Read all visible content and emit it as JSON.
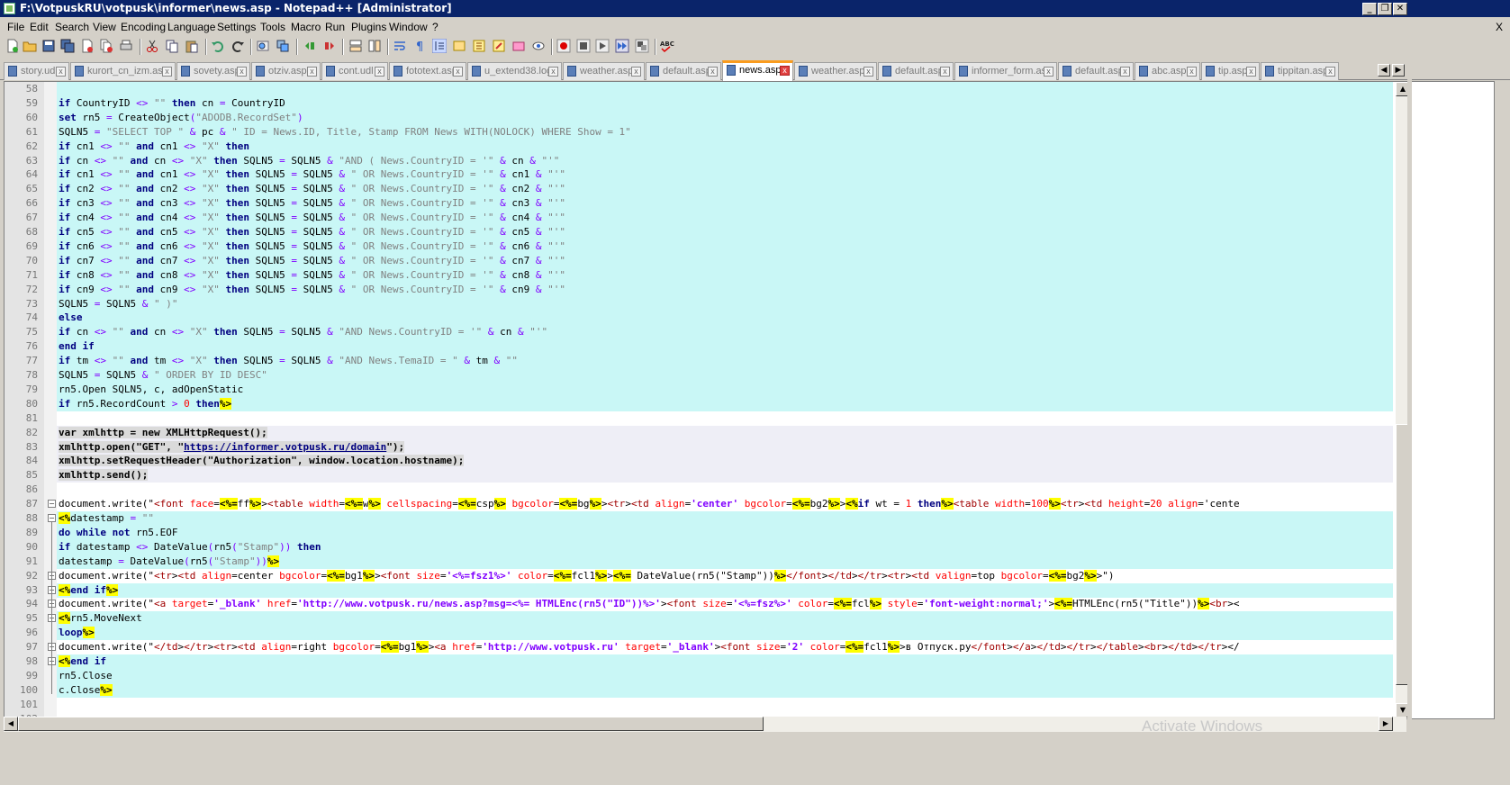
{
  "window": {
    "title": "F:\\VotpuskRU\\votpusk\\informer\\news.asp - Notepad++ [Administrator]",
    "controls": [
      "minimize",
      "restore",
      "close"
    ]
  },
  "menu": {
    "items": [
      "File",
      "Edit",
      "Search",
      "View",
      "Encoding",
      "Language",
      "Settings",
      "Tools",
      "Macro",
      "Run",
      "Plugins",
      "Window",
      "?"
    ],
    "close_label": "X"
  },
  "toolbar": {
    "icons": [
      "new-file-icon",
      "open-file-icon",
      "save-icon",
      "save-all-icon",
      "close-icon",
      "close-all-icon",
      "print-icon",
      "cut-icon",
      "copy-icon",
      "paste-icon",
      "undo-icon",
      "redo-icon",
      "find-icon",
      "replace-icon",
      "zoom-in-icon",
      "zoom-out-icon",
      "sync-v-icon",
      "sync-h-icon",
      "wrap-icon",
      "show-all-icon",
      "indent-guide-icon",
      "doc-map-icon",
      "function-list-icon",
      "folder-icon",
      "monitor-icon",
      "record-macro-icon",
      "stop-macro-icon",
      "play-macro-icon",
      "play-multiple-icon",
      "save-macro-icon",
      "spellcheck-icon"
    ],
    "spellcheck_label": "ABC"
  },
  "tabs": [
    {
      "label": "story.udl",
      "active": false
    },
    {
      "label": "kurort_cn_izm.asp",
      "active": false
    },
    {
      "label": "sovety.asp",
      "active": false
    },
    {
      "label": "otziv.asp",
      "active": false
    },
    {
      "label": "cont.udl",
      "active": false
    },
    {
      "label": "fototext.asp",
      "active": false
    },
    {
      "label": "u_extend38.log",
      "active": false
    },
    {
      "label": "weather.asp",
      "active": false
    },
    {
      "label": "default.asp",
      "active": false
    },
    {
      "label": "news.asp",
      "active": true
    },
    {
      "label": "weather.asp",
      "active": false
    },
    {
      "label": "default.asp",
      "active": false
    },
    {
      "label": "informer_form.asp",
      "active": false
    },
    {
      "label": "default.asp",
      "active": false
    },
    {
      "label": "abc.asp",
      "active": false
    },
    {
      "label": "tip.asp",
      "active": false
    },
    {
      "label": "tippitan.asp",
      "active": false
    }
  ],
  "editor": {
    "line_numbers": [
      "58",
      "59",
      "60",
      "61",
      "62",
      "63",
      "64",
      "65",
      "66",
      "67",
      "68",
      "69",
      "70",
      "71",
      "72",
      "73",
      "74",
      "75",
      "76",
      "77",
      "78",
      "79",
      "80",
      "81",
      "82",
      "83",
      "84",
      "85",
      "86",
      "87",
      "88",
      "89",
      "90",
      "91",
      "92",
      "93",
      "94",
      "95",
      "96",
      "97",
      "98",
      "99",
      "100",
      "101",
      "102"
    ],
    "lines": [
      "",
      "if CountryID <> \"\" then cn = CountryID",
      "set rn5 = CreateObject(\"ADODB.RecordSet\")",
      "SQLN5 = \"SELECT TOP \" & pc & \" ID = News.ID, Title, Stamp FROM News WITH(NOLOCK) WHERE Show = 1\"",
      "if cn1 <> \"\" and cn1 <> \"X\" then",
      "if cn <> \"\" and cn <> \"X\" then SQLN5 = SQLN5 & \"AND ( News.CountryID = '\" & cn & \"'\"",
      "if cn1 <> \"\" and cn1 <> \"X\" then SQLN5 = SQLN5 & \" OR News.CountryID = '\" & cn1 & \"'\"",
      "if cn2 <> \"\" and cn2 <> \"X\" then SQLN5 = SQLN5 & \" OR News.CountryID = '\" & cn2 & \"'\"",
      "if cn3 <> \"\" and cn3 <> \"X\" then SQLN5 = SQLN5 & \" OR News.CountryID = '\" & cn3 & \"'\"",
      "if cn4 <> \"\" and cn4 <> \"X\" then SQLN5 = SQLN5 & \" OR News.CountryID = '\" & cn4 & \"'\"",
      "if cn5 <> \"\" and cn5 <> \"X\" then SQLN5 = SQLN5 & \" OR News.CountryID = '\" & cn5 & \"'\"",
      "if cn6 <> \"\" and cn6 <> \"X\" then SQLN5 = SQLN5 & \" OR News.CountryID = '\" & cn6 & \"'\"",
      "if cn7 <> \"\" and cn7 <> \"X\" then SQLN5 = SQLN5 & \" OR News.CountryID = '\" & cn7 & \"'\"",
      "if cn8 <> \"\" and cn8 <> \"X\" then SQLN5 = SQLN5 & \" OR News.CountryID = '\" & cn8 & \"'\"",
      "if cn9 <> \"\" and cn9 <> \"X\" then SQLN5 = SQLN5 & \" OR News.CountryID = '\" & cn9 & \"'\"",
      "SQLN5 = SQLN5 & \" )\"",
      "else",
      "if cn <> \"\" and cn <> \"X\" then SQLN5 = SQLN5 & \"AND News.CountryID = '\" & cn & \"'\"",
      "end if",
      "if tm <> \"\" and tm <> \"X\" then SQLN5 = SQLN5 & \"AND News.TemaID = \" & tm & \"\"",
      "SQLN5 = SQLN5 & \" ORDER BY ID DESC\"",
      "rn5.Open SQLN5, c, adOpenStatic",
      "if rn5.RecordCount > 0 then%>",
      "",
      "var xmlhttp = new XMLHttpRequest();",
      "xmlhttp.open(\"GET\", \"https://informer.votpusk.ru/domain\");",
      "xmlhttp.setRequestHeader(\"Authorization\", window.location.hostname);",
      "xmlhttp.send();",
      "",
      "document.write(\"<font face=<%=ff%>><table width=<%=w%> cellspacing=<%=csp%> bgcolor=<%=bg%>><tr><td align='center' bgcolor=<%=bg2%>><%if wt = 1 then%><table width=100%><tr><td height=20 align='cente",
      "<%datestamp = \"\"",
      "do while not rn5.EOF",
      "if datestamp <> DateValue(rn5(\"Stamp\")) then",
      "datestamp = DateValue(rn5(\"Stamp\"))%>",
      "document.write(\"<tr><td align=center bgcolor=<%=bg1%>><font size='<%=fsz1%>' color=<%=fcl1%>><%= DateValue(rn5(\"Stamp\"))%></font></td></tr><tr><td valign=top bgcolor=<%=bg2%>>\")",
      "<%end if%>",
      "document.write(\"<a target='_blank' href='http://www.votpusk.ru/news.asp?msg=<%= HTMLEnc(rn5(\"ID\"))%>'><font size='<%=fsz%>' color=<%=fcl%> style='font-weight:normal;'><%=HTMLEnc(rn5(\"Title\"))%><br><",
      "<%rn5.MoveNext",
      "loop%>",
      "document.write(\"</td></tr><tr><td align=right bgcolor=<%=bg1%>><a href='http://www.votpusk.ru' target='_blank'><font size='2' color=<%=fcl1%>>в Отпуск.ру</font></a></td></tr></table><br></td></tr></",
      "<%end if",
      "rn5.Close",
      "c.Close%>",
      "",
      ""
    ]
  },
  "watermark": "Activate Windows",
  "colors": {
    "title_bar": "#0a246a",
    "cyan_highlight": "#c9f7f6",
    "asp_tag_highlight": "#ffff00",
    "active_tab_accent": "#fa9c1e"
  }
}
